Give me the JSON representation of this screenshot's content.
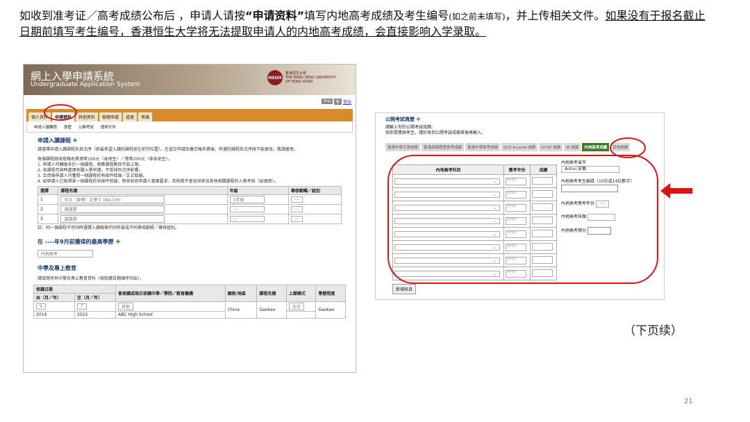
{
  "intro": {
    "p1": "如收到准考证／高考成绩公布后 ，申请人请按",
    "bold": "“申请资料”",
    "p2": "填写内地高考成绩及考生编号",
    "small": "(如之前未填写)",
    "p3": "，并上传相关文件。",
    "underlined": "如果没有于报名截止日期前填写考生编号，香港恒生大学将无法提取申请人的内地高考成绩，会直接影响入学录取。"
  },
  "left": {
    "title_zh": "網上入學申請系統",
    "title_en": "Undergraduate Application System",
    "logo_seal": "HSUH",
    "logo_zh": "香港恒生大學",
    "logo_en1": "THE HANG SENG UNIVERSITY",
    "logo_en2": "OF HONG KONG",
    "top_links": [
      "Eng",
      "繁",
      "登出"
    ],
    "nav_tabs": [
      "個人資料",
      "申請資料",
      "其他資料",
      "檢閱申請",
      "進度",
      "密碼"
    ],
    "sub_nav": [
      "申請入讀課程",
      "學歷",
      "公開考試",
      "證明文件"
    ],
    "sec1_title": "申請入讀課程",
    "sec1_p": "請選擇申請入讀課程及其次序（即最希望入讀的課程放在前列位置）。在遞交申請及繳交報名費後，所選的課程及次序將不能更改，敬請留意。",
    "notes": [
      "每個課程將收取報名費港幣100元（本地生）／港幣200元（非本地生）。",
      "1. 申請人可轉換多於一個課程，相應課程數目不設上限。",
      "2. 各課程可與時處理有關入學申請，不受排列次序影響。",
      "3. 合資格申請人只獲發一個課程的有條件取錄／正式取錄。",
      "4. 如申請人已取得某一個課程的有條件取錄，除非收到申請人書面要求，否則將不會安排參加其他相關課程的入學考核（如適用）。"
    ],
    "prog_headers": [
      "選擇",
      "課程名稱",
      "年級",
      "專修範疇／組別"
    ],
    "prog_rows": [
      [
        "1",
        "中文（榮譽）文學士 (BA-CHI)",
        "1年級",
        "---"
      ],
      [
        "2",
        "請選擇",
        "---",
        "---"
      ],
      [
        "3",
        "請選擇",
        "---",
        "---"
      ]
    ],
    "prog_note": "註：同一個課程不可同時選擇入讀兩個不同年級或不同專修範疇／專修組別。",
    "sec2_title": "在 ----年9月前獲得的最高學歷",
    "sec2_select": "內地高考",
    "sec3_title": "中學及專上教育",
    "sec3_p": "請填寫所有中學及專上教育資料（按就讀日期順序列出）。",
    "edu_headers": [
      "修讀日期",
      "由（月／年）",
      "至（月／年）",
      "曾修讀或現正修讀中學／學院／教育機構",
      "國家/地區",
      "課程名稱",
      "上課模式",
      "學歷程度"
    ],
    "edu_row": [
      "2019",
      "2022",
      "ABC High School",
      "China",
      "Gaokao",
      "全日",
      "Gaokao"
    ],
    "edu_row_sel": [
      "9",
      "7",
      "其他"
    ]
  },
  "right": {
    "title": "公開考試資歷",
    "note1": "請輸入你的公開考試成績。",
    "note2": "如你是應屆考生，請於收到公開考試成績單後再輸入。",
    "tabs": [
      "香港中學文憑成績",
      "香港高級程度會考成績",
      "香港中學會考成績",
      "GCE A-Level 成績",
      "GCSE 成績",
      "IB 成績",
      "內地高考成績",
      "其他成績"
    ],
    "headers": [
      "內地高考科目",
      "應考年份",
      "成績"
    ],
    "year_ph": "YYYY",
    "rows": 8,
    "province_label": "內地高考省市",
    "province_value": "Anhui 安徽",
    "exam_no_label": "內地高考考生編號（10位或14位數字）",
    "year_label": "內地高考應考年份",
    "year_value": "----",
    "type_label": "內地高考科類",
    "type_value": "-",
    "total_label": "內地高考總分",
    "add_btn": "新增科目"
  },
  "cont": "（下页续）",
  "page": "21"
}
